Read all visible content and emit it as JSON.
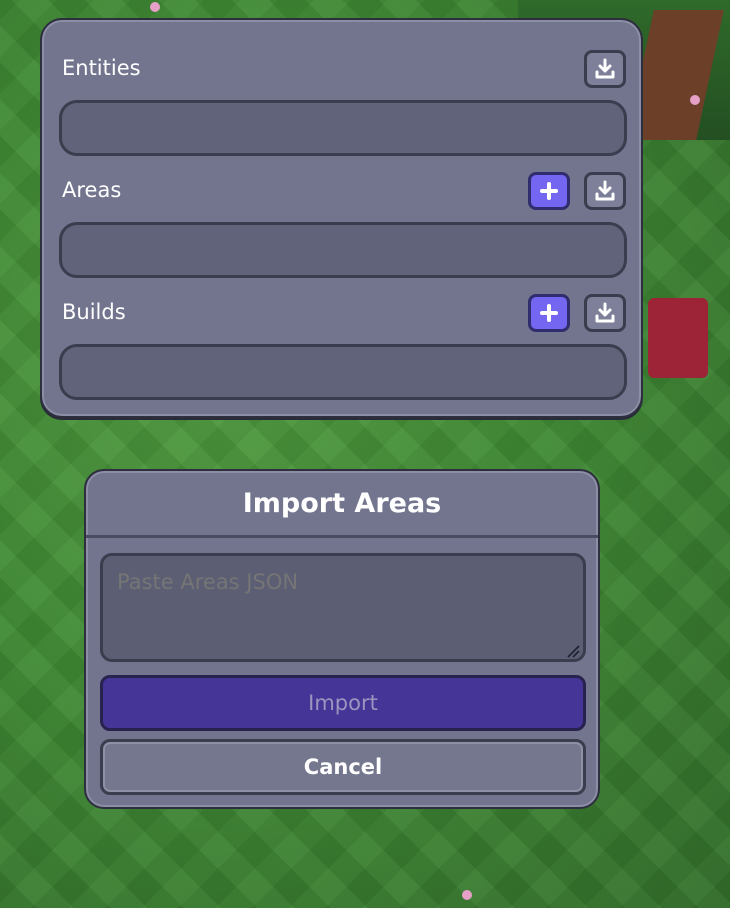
{
  "panel": {
    "rows": [
      {
        "label": "Entities",
        "has_add": false
      },
      {
        "label": "Areas",
        "has_add": true
      },
      {
        "label": "Builds",
        "has_add": true
      }
    ],
    "icons": {
      "add": "plus-icon",
      "download": "download-icon"
    }
  },
  "dialog": {
    "title": "Import Areas",
    "placeholder": "Paste Areas JSON",
    "import_label": "Import",
    "cancel_label": "Cancel"
  },
  "colors": {
    "panel_bg": "#73758f",
    "field_bg": "#61637a",
    "add_button": "#7466f0",
    "import_button": "#453597",
    "grass": "#3f8a34"
  }
}
